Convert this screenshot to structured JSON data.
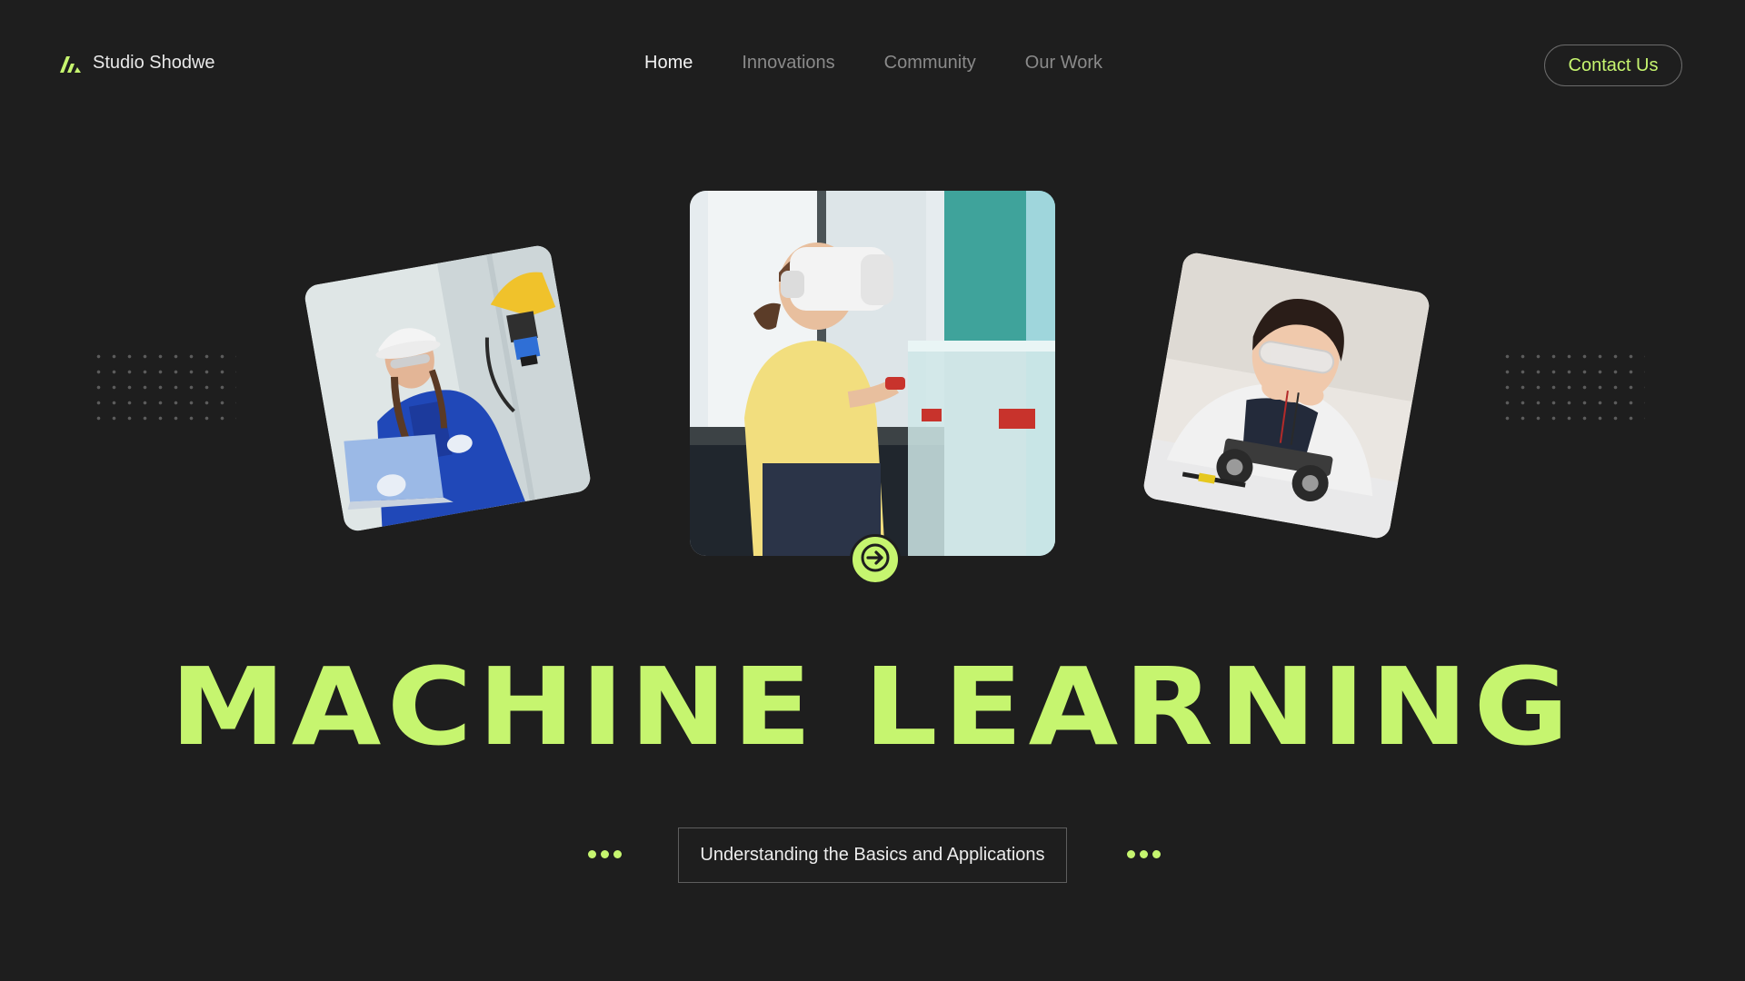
{
  "brand": {
    "name": "Studio Shodwe",
    "icon": "brand-logo-icon"
  },
  "nav": {
    "items": [
      {
        "label": "Home",
        "active": true
      },
      {
        "label": "Innovations",
        "active": false
      },
      {
        "label": "Community",
        "active": false
      },
      {
        "label": "Our Work",
        "active": false
      }
    ]
  },
  "header": {
    "contact_label": "Contact Us"
  },
  "hero": {
    "title": "MACHINE LEARNING",
    "subtitle": "Understanding the Basics and Applications",
    "next_icon": "arrow-right-icon"
  },
  "colors": {
    "background": "#1e1e1e",
    "accent": "#c6f56f",
    "nav_inactive": "#8a8a8a",
    "nav_active": "#f2f2f2"
  }
}
